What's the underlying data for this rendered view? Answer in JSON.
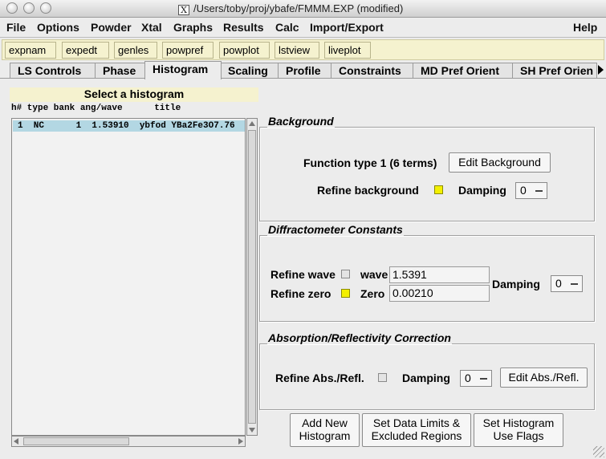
{
  "window": {
    "title": "/Users/toby/proj/ybafe/FMMM.EXP (modified)"
  },
  "menu": [
    "File",
    "Options",
    "Powder",
    "Xtal",
    "Graphs",
    "Results",
    "Calc",
    "Import/Export",
    "Help"
  ],
  "toolbar": [
    "expnam",
    "expedt",
    "genles",
    "powpref",
    "powplot",
    "lstview",
    "liveplot"
  ],
  "tabs": [
    "LS Controls",
    "Phase",
    "Histogram",
    "Scaling",
    "Profile",
    "Constraints",
    "MD Pref Orient",
    "SH Pref Orien"
  ],
  "active_tab": "Histogram",
  "histogram_list": {
    "title": "Select a histogram",
    "header": "h# type bank ang/wave      title",
    "rows": [
      {
        "text": "1  NC      1  1.53910  ybfod YBa2Fe3O7.76"
      }
    ]
  },
  "background": {
    "legend": "Background",
    "function_label": "Function type 1  (6 terms)",
    "edit_button": "Edit Background",
    "refine_label": "Refine background",
    "refine_checked": true,
    "damping_label": "Damping",
    "damping_value": "0"
  },
  "diffractometer": {
    "legend": "Diffractometer Constants",
    "refine_wave_label": "Refine wave",
    "refine_wave_checked": false,
    "wave_label": "wave",
    "wave_value": "1.5391",
    "refine_zero_label": "Refine zero",
    "refine_zero_checked": true,
    "zero_label": "Zero",
    "zero_value": "0.00210",
    "damping_label": "Damping",
    "damping_value": "0"
  },
  "absorption": {
    "legend": "Absorption/Reflectivity Correction",
    "refine_label": "Refine Abs./Refl.",
    "refine_checked": false,
    "damping_label": "Damping",
    "damping_value": "0",
    "edit_button": "Edit Abs./Refl."
  },
  "actions": {
    "add_new": [
      "Add New",
      "Histogram"
    ],
    "set_limits": [
      "Set Data Limits &",
      "Excluded Regions"
    ],
    "set_flags": [
      "Set Histogram",
      "Use Flags"
    ]
  },
  "colors": {
    "toolbar_bg": "#f5f2cf",
    "selected_row": "#b3d7e3",
    "checkbox_on": "#f3f000"
  }
}
